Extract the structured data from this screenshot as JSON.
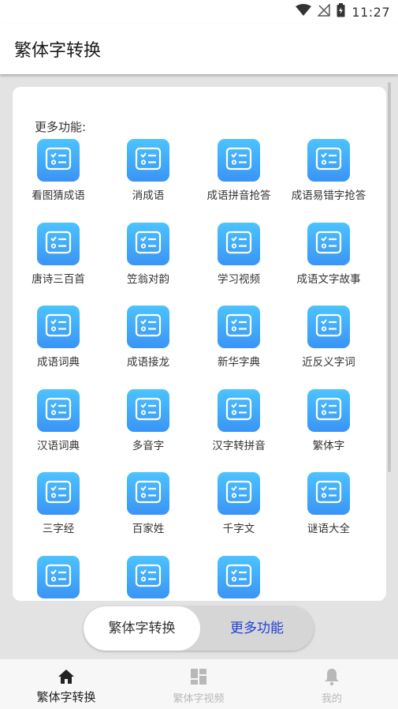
{
  "status_bar": {
    "time": "11:27"
  },
  "app_bar": {
    "title": "繁体字转换"
  },
  "card": {
    "heading": "更多功能:",
    "items": [
      {
        "label": "看图猜成语"
      },
      {
        "label": "消成语"
      },
      {
        "label": "成语拼音抢答"
      },
      {
        "label": "成语易错字抢答"
      },
      {
        "label": "唐诗三百首"
      },
      {
        "label": "笠翁对韵"
      },
      {
        "label": "学习视频"
      },
      {
        "label": "成语文字故事"
      },
      {
        "label": "成语词典"
      },
      {
        "label": "成语接龙"
      },
      {
        "label": "新华字典"
      },
      {
        "label": "近反义字词"
      },
      {
        "label": "汉语词典"
      },
      {
        "label": "多音字"
      },
      {
        "label": "汉字转拼音"
      },
      {
        "label": "繁体字"
      },
      {
        "label": "三字经"
      },
      {
        "label": "百家姓"
      },
      {
        "label": "千字文"
      },
      {
        "label": "谜语大全"
      },
      {
        "label": ""
      },
      {
        "label": ""
      },
      {
        "label": ""
      }
    ]
  },
  "toggle": {
    "left_label": "繁体字转换",
    "right_label": "更多功能",
    "active": "right"
  },
  "bottom_nav": {
    "items": [
      {
        "label": "繁体字转换",
        "icon": "home-icon",
        "active": true
      },
      {
        "label": "繁体字视频",
        "icon": "dashboard-icon",
        "active": false
      },
      {
        "label": "我的",
        "icon": "bell-icon",
        "active": false
      }
    ]
  },
  "colors": {
    "tile_top": "#4cc3ff",
    "tile_bottom": "#3a94f5",
    "toggle_active_text": "#1f3fd6"
  }
}
